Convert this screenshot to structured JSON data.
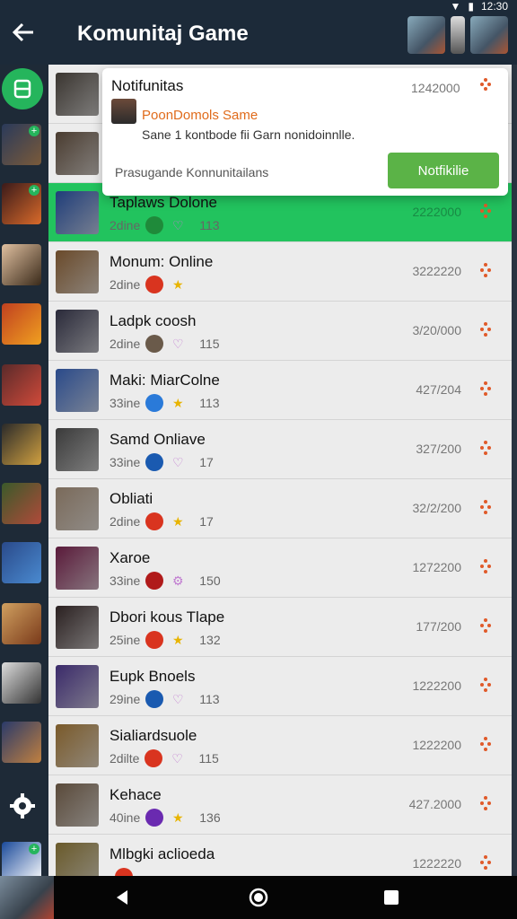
{
  "header": {
    "title": "Komunitaj Game",
    "status_time": "12:30"
  },
  "popup": {
    "title": "Notifunitas",
    "score": "1242000",
    "name": "PoonDomols Same",
    "message": "Sane 1 kontbode fii Garn nonidoinnlle.",
    "footer": "Prasugande Konnunitailans",
    "button_label": "Notfikilie"
  },
  "rows": [
    {
      "name": "",
      "meta": "",
      "count": "",
      "score": "1242000",
      "thumb": "#3a3530"
    },
    {
      "name": "",
      "meta": "",
      "count": "",
      "score": "",
      "thumb": "#4a3c30"
    },
    {
      "name": "Taplaws Dolone",
      "meta": "2dine",
      "count": "113",
      "score": "2222000",
      "thumb": "#1f3d7a",
      "icon_color": "#1f8a3a",
      "glyph": "♡"
    },
    {
      "name": "Monum: Online",
      "meta": "2dine",
      "count": "",
      "score": "3222220",
      "thumb": "#6a4a2a",
      "icon_color": "#d9341f",
      "glyph": "★"
    },
    {
      "name": "Ladpk coosh",
      "meta": "2dine",
      "count": "115",
      "score": "3/20/000",
      "thumb": "#2a2a3a",
      "icon_color": "#6a5a4a",
      "glyph": "♡"
    },
    {
      "name": "Maki: MiarColne",
      "meta": "33ine",
      "count": "113",
      "score": "427/204",
      "thumb": "#2a4a8a",
      "icon_color": "#2a7ad9",
      "glyph": "★"
    },
    {
      "name": "Samd Onliave",
      "meta": "33ine",
      "count": "17",
      "score": "327/200",
      "thumb": "#3a3a3a",
      "icon_color": "#1a5ab0",
      "glyph": "♡"
    },
    {
      "name": "Obliati",
      "meta": "2dine",
      "count": "17",
      "score": "32/2/200",
      "thumb": "#7a6a5a",
      "icon_color": "#d9341f",
      "glyph": "★"
    },
    {
      "name": "Xaroe",
      "meta": "33ine",
      "count": "150",
      "score": "1272200",
      "thumb": "#5a1a3a",
      "icon_color": "#b01a1a",
      "glyph": "⚙"
    },
    {
      "name": "Dbori kous Tlape",
      "meta": "25ine",
      "count": "132",
      "score": "177/200",
      "thumb": "#2a2020",
      "icon_color": "#d9341f",
      "glyph": "★"
    },
    {
      "name": "Eupk Bnoels",
      "meta": "29ine",
      "count": "113",
      "score": "1222200",
      "thumb": "#3a2a6a",
      "icon_color": "#1a5ab0",
      "glyph": "♡"
    },
    {
      "name": "Sialiardsuole",
      "meta": "2dilte",
      "count": "115",
      "score": "1222200",
      "thumb": "#7a5a2a",
      "icon_color": "#d9341f",
      "glyph": "♡"
    },
    {
      "name": "Kehace",
      "meta": "40ine",
      "count": "136",
      "score": "427.2000",
      "thumb": "#5a4a3a",
      "icon_color": "#6a2ab0",
      "glyph": "★"
    },
    {
      "name": "Mlbgki aclioeda",
      "meta": "",
      "count": "",
      "score": "1222220",
      "thumb": "#6a5a2a",
      "icon_color": "#d9341f",
      "glyph": ""
    }
  ],
  "colors": {
    "accent": "#22c35e",
    "header_bg": "#1c2a39",
    "list_bg": "#ececec",
    "menu_icon": "#e05a2a"
  }
}
